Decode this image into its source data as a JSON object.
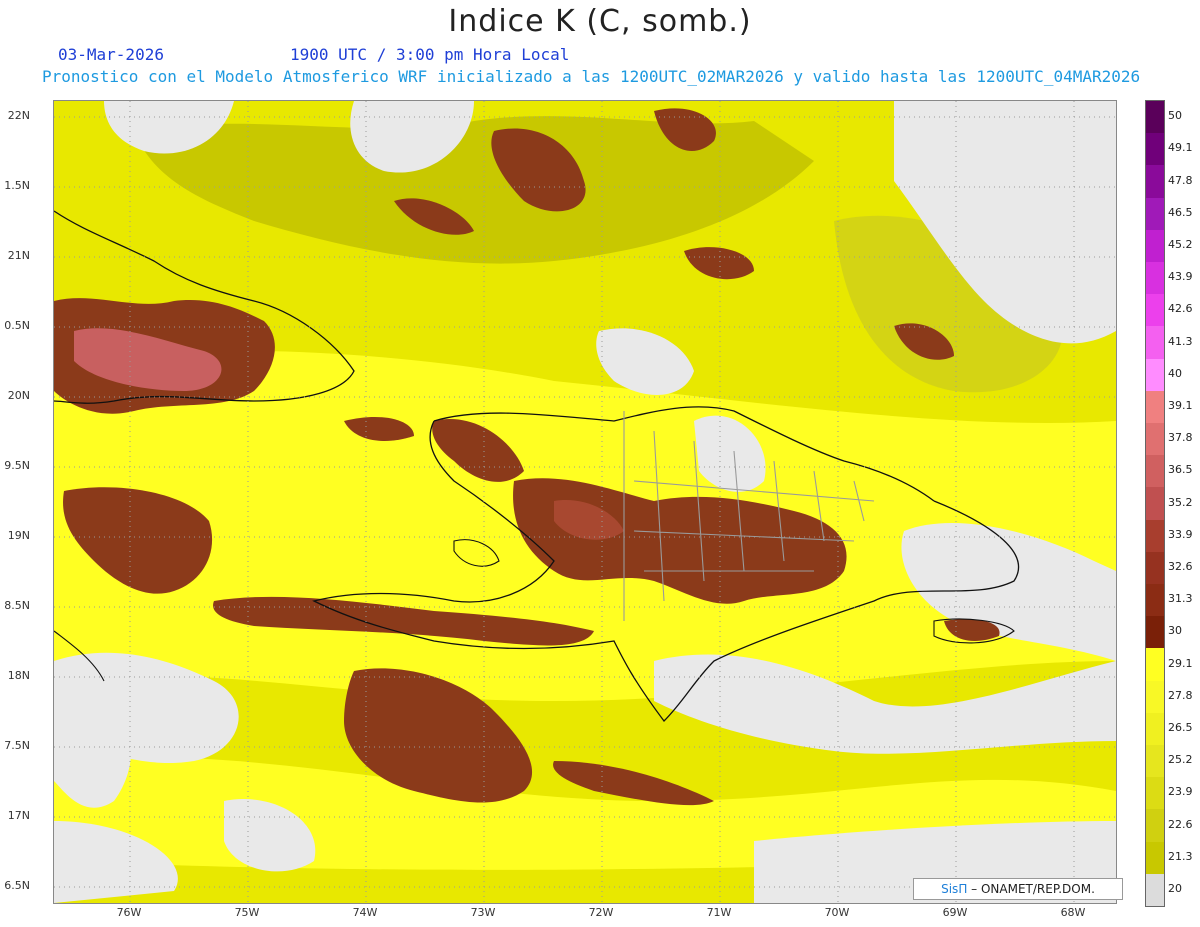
{
  "header": {
    "title": "Indice K (C, somb.)",
    "date": "03-Mar-2026",
    "time": "1900 UTC / 3:00 pm Hora Local",
    "info": "Pronostico con el Modelo Atmosferico WRF inicializado a las 1200UTC_02MAR2026 y valido hasta las  1200UTC_04MAR2026"
  },
  "map": {
    "lat_labels": [
      "22N",
      "1.5N",
      "21N",
      "0.5N",
      "20N",
      "9.5N",
      "19N",
      "8.5N",
      "18N",
      "7.5N",
      "17N",
      "6.5N"
    ],
    "lon_labels": [
      "76W",
      "75W",
      "74W",
      "73W",
      "72W",
      "71W",
      "70W",
      "69W",
      "68W"
    ],
    "colors": {
      "no_data": "#e9e9e9",
      "low": "#c8c800",
      "mid": "#e8e800",
      "high": "#ffff22",
      "storm": "#8b3a1a",
      "storm_light": "#c86060",
      "coast": "#111111",
      "border": "#9a9a9a"
    }
  },
  "colorbar": {
    "labels": [
      "50",
      "49.1",
      "47.8",
      "46.5",
      "45.2",
      "43.9",
      "42.6",
      "41.3",
      "40",
      "39.1",
      "37.8",
      "36.5",
      "35.2",
      "33.9",
      "32.6",
      "31.3",
      "30",
      "29.1",
      "27.8",
      "26.5",
      "25.2",
      "23.9",
      "22.6",
      "21.3",
      "20"
    ],
    "colors": [
      "#5a005a",
      "#70007a",
      "#8a0a9a",
      "#a01ab8",
      "#c020d0",
      "#d830e0",
      "#ec40ec",
      "#f460f0",
      "#ff8cff",
      "#f08080",
      "#e07070",
      "#d06060",
      "#c05050",
      "#a83e2e",
      "#963220",
      "#8b2c14",
      "#7a2008",
      "#ffff22",
      "#f8f826",
      "#f0f020",
      "#e6e61e",
      "#dcdc14",
      "#d0d010",
      "#c8c800",
      "#dcdcdc"
    ]
  },
  "credit": {
    "sis": "SisΠ",
    "rest": "– ONAMET/REP.DOM."
  }
}
